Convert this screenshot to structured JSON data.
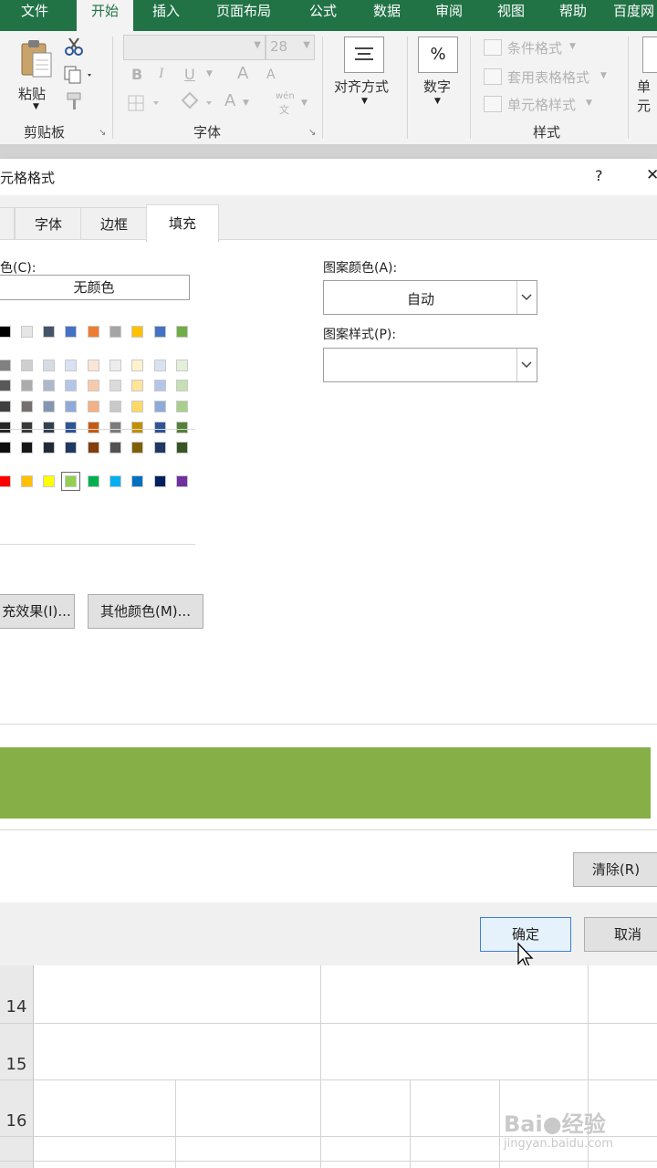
{
  "ribbon": {
    "tabs": [
      "文件",
      "开始",
      "插入",
      "页面布局",
      "公式",
      "数据",
      "审阅",
      "视图",
      "帮助",
      "百度网"
    ],
    "active_tab": "开始",
    "clipboard": {
      "paste_label": "粘贴",
      "group_label": "剪贴板"
    },
    "font": {
      "font_name": "",
      "font_size": "28",
      "bold": "B",
      "italic": "I",
      "underline": "U",
      "grow": "A",
      "shrink": "A",
      "font_color": "A",
      "phonetic_top": "wén",
      "phonetic_bottom": "文",
      "group_label": "字体"
    },
    "alignment": {
      "label": "对齐方式"
    },
    "number": {
      "label": "数字",
      "icon_text": "%"
    },
    "styles": {
      "conditional": "条件格式",
      "table_format": "套用表格格式",
      "cell_styles": "单元格样式",
      "group_label": "样式"
    },
    "cells": {
      "label": "单元"
    }
  },
  "dialog": {
    "title": "元格格式",
    "help": "?",
    "close": "✕",
    "tabs": [
      "字体",
      "边框",
      "填充"
    ],
    "active_tab": "填充",
    "background_color_label": "色(C):",
    "no_color_button": "无颜色",
    "theme_row": [
      "#000000",
      "#e7e6e6",
      "#44546a",
      "#4472c4",
      "#ed7d31",
      "#a5a5a5",
      "#ffc000",
      "#4472c4",
      "#70ad47"
    ],
    "tint_rows": [
      [
        "#808080",
        "#d0cece",
        "#d6dce4",
        "#d9e2f3",
        "#fbe5d5",
        "#ededed",
        "#fff2cc",
        "#d9e2f3",
        "#e2efd9"
      ],
      [
        "#595959",
        "#aeabab",
        "#adb9ca",
        "#b4c6e7",
        "#f7caac",
        "#dbdbdb",
        "#ffe599",
        "#b4c6e7",
        "#c5e0b3"
      ],
      [
        "#3f3f3f",
        "#757070",
        "#8496b0",
        "#8eaadb",
        "#f4b183",
        "#c9c9c9",
        "#ffd966",
        "#8eaadb",
        "#a8d08d"
      ],
      [
        "#262626",
        "#3a3838",
        "#323f4f",
        "#2f5496",
        "#c55a11",
        "#7b7b7b",
        "#bf9000",
        "#2f5496",
        "#538135"
      ],
      [
        "#0d0d0d",
        "#171616",
        "#222a35",
        "#1f3864",
        "#833c0b",
        "#525252",
        "#7f6000",
        "#1f3864",
        "#375623"
      ]
    ],
    "standard_row": [
      "#ff0000",
      "#ffc000",
      "#ffff00",
      "#92d050",
      "#00b050",
      "#00b0f0",
      "#0070c0",
      "#002060",
      "#7030a0"
    ],
    "selected_standard_index": 3,
    "fill_effects_button": "充效果(I)...",
    "more_colors_button": "其他颜色(M)...",
    "pattern_color_label": "图案颜色(A):",
    "pattern_color_value": "自动",
    "pattern_style_label": "图案样式(P):",
    "pattern_style_value": "",
    "sample_color": "#86b047",
    "clear_button": "清除(R)",
    "ok_button": "确定",
    "cancel_button": "取消"
  },
  "grid": {
    "rows": [
      "14",
      "15",
      "16"
    ]
  },
  "watermark": {
    "brand": "Bai●经验",
    "url": "jingyan.baidu.com"
  }
}
